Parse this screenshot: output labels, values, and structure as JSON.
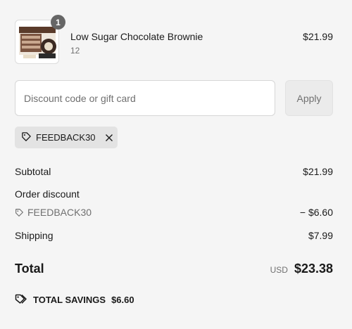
{
  "line_item": {
    "quantity": "1",
    "name": "Low Sugar Chocolate Brownie",
    "variant": "12",
    "price": "$21.99"
  },
  "discount": {
    "placeholder": "Discount code or gift card",
    "apply_label": "Apply",
    "applied_code": "FEEDBACK30"
  },
  "summary": {
    "subtotal_label": "Subtotal",
    "subtotal_value": "$21.99",
    "order_discount_label": "Order discount",
    "discount_code": "FEEDBACK30",
    "discount_value": "− $6.60",
    "shipping_label": "Shipping",
    "shipping_value": "$7.99",
    "total_label": "Total",
    "currency": "USD",
    "total_value": "$23.38",
    "savings_label": "TOTAL SAVINGS",
    "savings_value": "$6.60"
  },
  "icons": {
    "tag": "tag-icon",
    "remove": "close-icon",
    "savings": "tags-icon"
  },
  "colors": {
    "background": "#f5f5f5",
    "muted_text": "#707070",
    "badge": "#666666",
    "chip": "#e3e3e3"
  }
}
